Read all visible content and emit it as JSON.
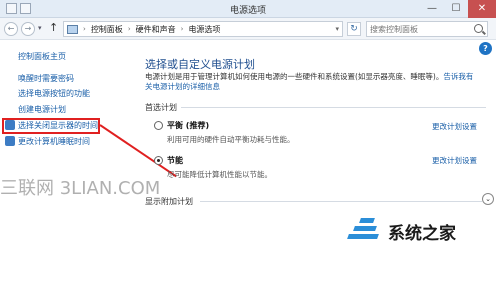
{
  "window": {
    "title": "电源选项",
    "min": "—",
    "max": "☐",
    "close": "✕"
  },
  "address": {
    "back": "←",
    "forward": "→",
    "down": "▾",
    "up": "↑",
    "breadcrumb": [
      "控制面板",
      "硬件和声音",
      "电源选项"
    ],
    "separator": "›",
    "refresh": "↻",
    "search_placeholder": "搜索控制面板"
  },
  "help": "?",
  "sidebar": {
    "home": "控制面板主页",
    "items": [
      {
        "label": "唤醒时需要密码"
      },
      {
        "label": "选择电源按钮的功能"
      },
      {
        "label": "创建电源计划"
      },
      {
        "label": "选择关闭显示器的时间",
        "highlighted": true
      },
      {
        "label": "更改计算机睡眠时间"
      }
    ]
  },
  "main": {
    "title": "选择或自定义电源计划",
    "description_prefix": "电源计划是用于管理计算机如何使用电源的一些硬件和系统设置(如显示器亮度、睡眠等)。",
    "description_link": "告诉我有关电源计划的详细信息",
    "section_label": "首选计划",
    "plans": [
      {
        "name": "平衡 (推荐)",
        "description": "利用可用的硬件自动平衡功耗与性能。",
        "selected": false,
        "link": "更改计划设置"
      },
      {
        "name": "节能",
        "description": "尽可能降低计算机性能以节能。",
        "selected": true,
        "link": "更改计划设置"
      }
    ],
    "more_label": "显示附加计划",
    "expand": "⌄"
  },
  "watermarks": {
    "left": "三联网 3LIAN.COM",
    "right": "系统之家"
  },
  "colors": {
    "link": "#1a5fa8",
    "title": "#1f4e8f",
    "highlight": "#e02020",
    "close_button": "#c75050"
  }
}
